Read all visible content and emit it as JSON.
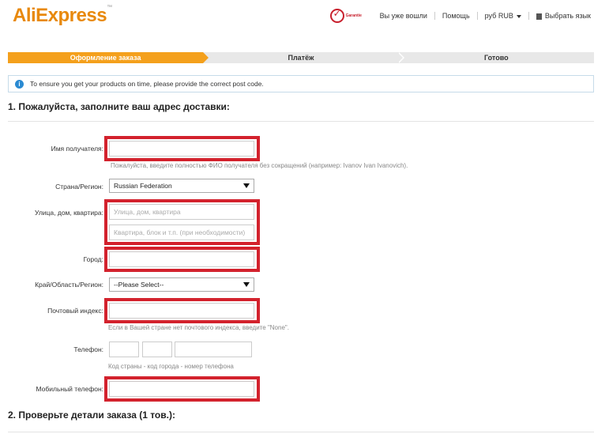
{
  "header": {
    "logo": "AliExpress",
    "badge_text": "Garantie",
    "links": [
      "Вы уже вошли",
      "Помощь",
      "руб RUB",
      "Выбрать язык"
    ]
  },
  "steps": [
    "Оформление заказа",
    "Платёж",
    "Готово"
  ],
  "notice": "To ensure you get your products on time, please provide the correct post code.",
  "section1_title": "1. Пожалуйста, заполните ваш адрес доставки:",
  "form": {
    "name_label": "Имя получателя:",
    "name_hint": "Пожалуйста, введите полностью ФИО получателя без сокращений (например: Ivanov Ivan Ivanovich).",
    "country_label": "Страна/Регион:",
    "country_value": "Russian Federation",
    "street_label": "Улица, дом, квартира:",
    "street_placeholder": "Улица, дом, квартира",
    "street2_placeholder": "Квартира, блок и т.п. (при необходимости)",
    "city_label": "Город:",
    "region_label": "Край/Область/Регион:",
    "region_value": "--Please Select--",
    "zip_label": "Почтовый индекс:",
    "zip_hint": "Если в Вашей стране нет почтового индекса, введите \"None\".",
    "phone_label": "Телефон:",
    "phone_hint": "Код страны - код города - номер телефона",
    "mobile_label": "Мобильный телефон:"
  },
  "section2_title": "2. Проверьте детали заказа (1 тов.):",
  "colors": {
    "accent": "#f4a01c",
    "highlight": "#d3222d",
    "info": "#2a8ad2"
  }
}
